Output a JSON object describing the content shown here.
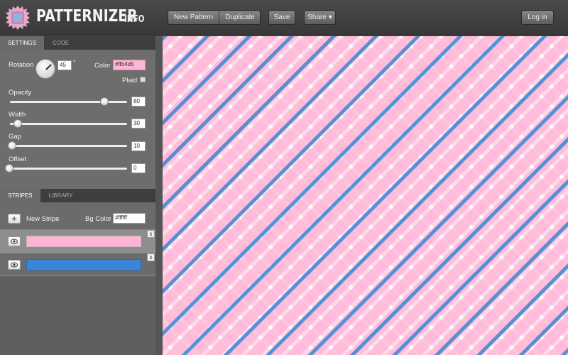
{
  "header": {
    "logo_text": "PATTERNIZER",
    "info_label": "INFO",
    "new_pattern_label": "New Pattern",
    "duplicate_label": "Duplicate",
    "save_label": "Save",
    "share_label": "Share ▾",
    "login_label": "Log in"
  },
  "settings_tabs": [
    {
      "label": "SETTINGS",
      "active": true
    },
    {
      "label": "CODE",
      "active": false
    }
  ],
  "settings": {
    "rotation_label": "Rotation",
    "rotation_value": "45",
    "degree_symbol": "°",
    "color_label": "Color",
    "color_value": "#ffb4d5",
    "plaid_label": "Plaid",
    "plaid_checked": false,
    "opacity_label": "Opacity",
    "opacity_value": "80",
    "width_label": "Width",
    "width_value": "30",
    "gap_label": "Gap",
    "gap_value": "10",
    "offset_label": "Offset",
    "offset_value": "0"
  },
  "stripes_tabs": [
    {
      "label": "STRIPES",
      "active": true
    },
    {
      "label": "LIBRARY",
      "active": false
    }
  ],
  "stripes": {
    "new_stripe_label": "New Stripe",
    "bg_color_label": "Bg Color",
    "bg_color_value": "#ffffff",
    "items": [
      {
        "color": "#ffb4d5",
        "selected": true
      },
      {
        "color": "#3a86d6",
        "selected": false
      }
    ],
    "close_label": "x"
  },
  "colors": {
    "pink": "#ffb4d5",
    "blue": "#3a86d6",
    "background": "#ffffff"
  }
}
